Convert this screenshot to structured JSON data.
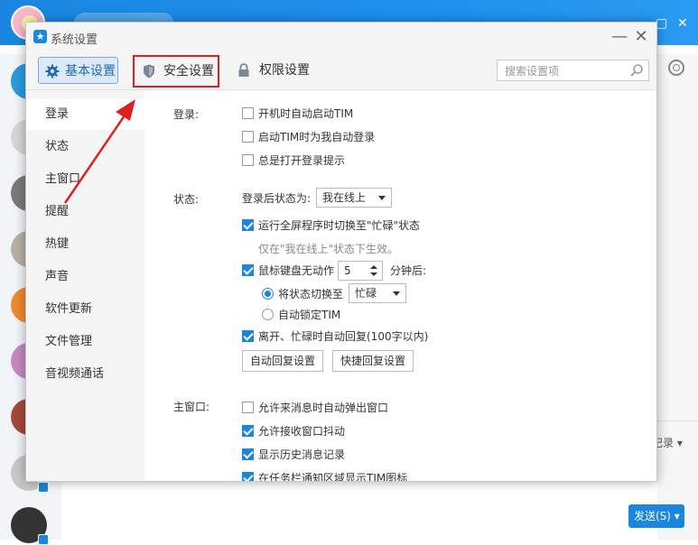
{
  "background": {
    "send_label": "发送(S)",
    "record_label": "记录",
    "accent_color": "#1a86e0"
  },
  "window": {
    "title": "系统设置",
    "minimize_glyph": "—",
    "close_glyph": "✕"
  },
  "tabs": [
    {
      "label": "基本设置",
      "icon": "gear-icon",
      "selected": true
    },
    {
      "label": "安全设置",
      "icon": "shield-icon",
      "highlighted": true
    },
    {
      "label": "权限设置",
      "icon": "lock-icon"
    }
  ],
  "search": {
    "placeholder": "搜索设置项",
    "value": ""
  },
  "sidebar": {
    "items": [
      {
        "label": "登录",
        "active": true
      },
      {
        "label": "状态"
      },
      {
        "label": "主窗口"
      },
      {
        "label": "提醒"
      },
      {
        "label": "热键"
      },
      {
        "label": "声音"
      },
      {
        "label": "软件更新"
      },
      {
        "label": "文件管理"
      },
      {
        "label": "音视频通话"
      }
    ]
  },
  "login": {
    "section_label": "登录:",
    "options": [
      {
        "label": "开机时自动启动TIM",
        "checked": false
      },
      {
        "label": "启动TIM时为我自动登录",
        "checked": false
      },
      {
        "label": "总是打开登录提示",
        "checked": false
      }
    ]
  },
  "status": {
    "section_label": "状态:",
    "after_login_label": "登录后状态为:",
    "after_login_value": "我在线上",
    "fullscreen_busy": {
      "label": "运行全屏程序时切换至\"忙碌\"状态",
      "checked": true
    },
    "fullscreen_hint": "仅在\"我在线上\"状态下生效。",
    "idle": {
      "label": "鼠标键盘无动作",
      "checked": true,
      "minutes": "5",
      "unit": "分钟后:"
    },
    "idle_switch": {
      "label": "将状态切换至",
      "checked": true,
      "value": "忙碌"
    },
    "idle_lock": {
      "label": "自动锁定TIM",
      "checked": false
    },
    "auto_reply": {
      "label": "离开、忙碌时自动回复(100字以内)",
      "checked": true
    },
    "auto_reply_button": "自动回复设置",
    "quick_reply_button": "快捷回复设置"
  },
  "main_window": {
    "section_label": "主窗口:",
    "options": [
      {
        "label": "允许来消息时自动弹出窗口",
        "checked": false
      },
      {
        "label": "允许接收窗口抖动",
        "checked": true
      },
      {
        "label": "显示历史消息记录",
        "checked": true
      },
      {
        "label": "在任务栏通知区域显示TIM图标",
        "checked": true
      }
    ]
  },
  "annotation": {
    "highlight_color": "#e02020"
  }
}
